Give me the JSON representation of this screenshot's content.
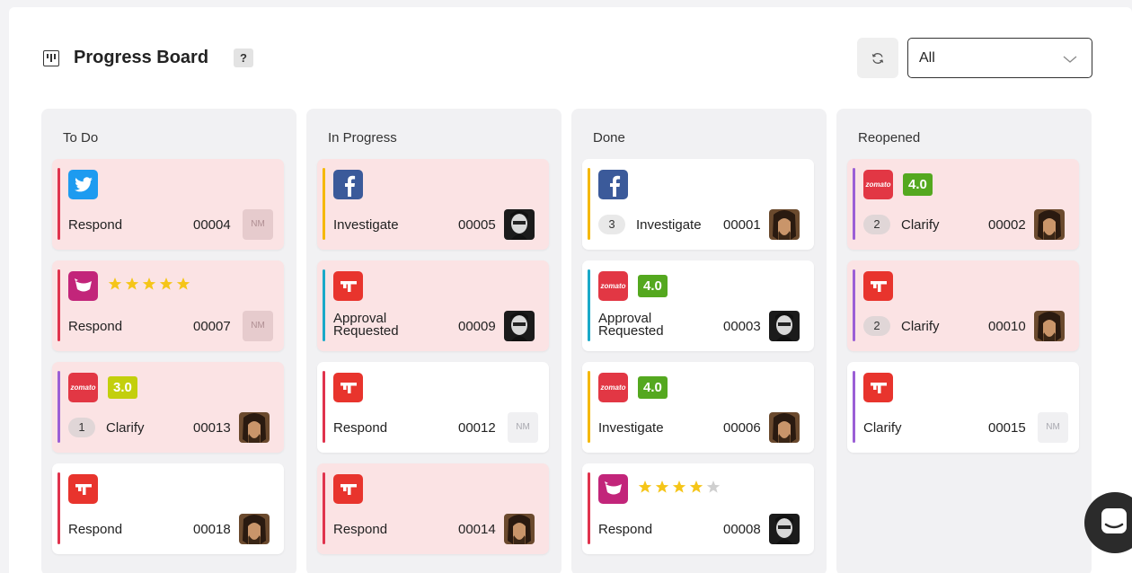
{
  "header": {
    "title": "Progress Board",
    "help": "?",
    "filter_value": "All"
  },
  "colors": {
    "red": "#e0334d",
    "yellow": "#f5b800",
    "teal": "#1aa9c8",
    "purple": "#9b5fd6",
    "rating_green": "#54a81f",
    "rating_lime": "#c3cf0d",
    "star": "#f5c518"
  },
  "columns": [
    {
      "title": "To Do",
      "cards": [
        {
          "source": "twitter",
          "action": "Respond",
          "id": "00004",
          "assignee": "NM",
          "bar": "red",
          "pink": true
        },
        {
          "source": "brand",
          "stars": 5,
          "action": "Respond",
          "id": "00007",
          "assignee": "NM",
          "bar": "red",
          "pink": true
        },
        {
          "source": "zomato",
          "rating": "3.0",
          "rating_color": "lime",
          "count": "1",
          "action": "Clarify",
          "id": "00013",
          "avatar": "dark",
          "bar": "purple",
          "pink": true
        },
        {
          "source": "tripadvisor",
          "action": "Respond",
          "id": "00018",
          "avatar": "dark",
          "bar": "red",
          "pink": false
        }
      ]
    },
    {
      "title": "In Progress",
      "cards": [
        {
          "source": "facebook",
          "action": "Investigate",
          "id": "00005",
          "avatar": "bw",
          "bar": "yellow",
          "pink": true
        },
        {
          "source": "tripadvisor",
          "action": "Approval Requested",
          "id": "00009",
          "avatar": "bw",
          "bar": "teal",
          "pink": true
        },
        {
          "source": "tripadvisor",
          "action": "Respond",
          "id": "00012",
          "assignee": "NM",
          "bar": "red",
          "pink": false
        },
        {
          "source": "tripadvisor",
          "action": "Respond",
          "id": "00014",
          "avatar": "dark",
          "bar": "red",
          "pink": true
        }
      ]
    },
    {
      "title": "Done",
      "cards": [
        {
          "source": "facebook",
          "count": "3",
          "action": "Investigate",
          "id": "00001",
          "avatar": "dark",
          "bar": "yellow",
          "pink": false
        },
        {
          "source": "zomato",
          "rating": "4.0",
          "rating_color": "green",
          "action": "Approval Requested",
          "id": "00003",
          "avatar": "bw",
          "bar": "teal",
          "pink": false
        },
        {
          "source": "zomato",
          "rating": "4.0",
          "rating_color": "green",
          "action": "Investigate",
          "id": "00006",
          "avatar": "dark",
          "bar": "yellow",
          "pink": false
        },
        {
          "source": "brand",
          "stars": 4,
          "action": "Respond",
          "id": "00008",
          "avatar": "bw",
          "bar": "red",
          "pink": false
        }
      ]
    },
    {
      "title": "Reopened",
      "cards": [
        {
          "source": "zomato",
          "rating": "4.0",
          "rating_color": "green",
          "count": "2",
          "action": "Clarify",
          "id": "00002",
          "avatar": "dark",
          "bar": "purple",
          "pink": true
        },
        {
          "source": "tripadvisor",
          "count": "2",
          "action": "Clarify",
          "id": "00010",
          "avatar": "dark",
          "bar": "purple",
          "pink": true
        },
        {
          "source": "tripadvisor",
          "action": "Clarify",
          "id": "00015",
          "assignee": "NM",
          "bar": "purple",
          "pink": false
        }
      ]
    }
  ],
  "source_labels": {
    "zomato": "zomato"
  }
}
